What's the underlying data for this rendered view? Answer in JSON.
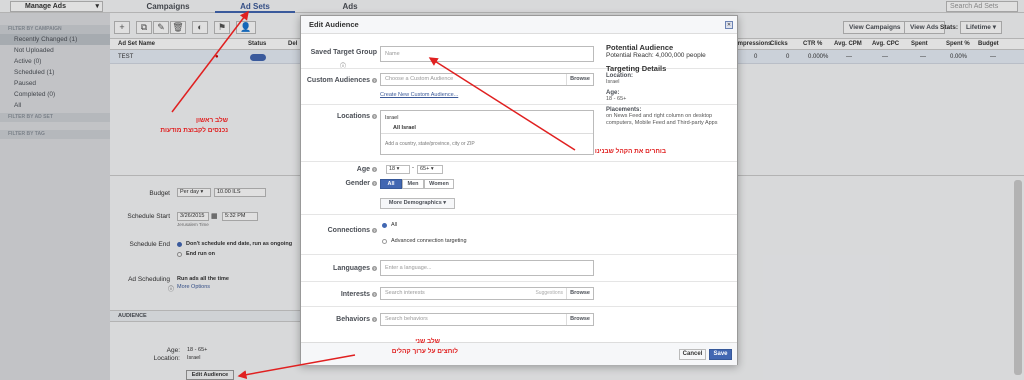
{
  "topbar": {
    "manage_label": "Manage Ads",
    "tabs": [
      "Campaigns",
      "Ad Sets",
      "Ads"
    ],
    "search_placeholder": "Search Ad Sets"
  },
  "sidebar": {
    "filter_campaign": "FILTER BY CAMPAIGN",
    "items": [
      "Recently Changed (1)",
      "Not Uploaded",
      "Active (0)",
      "Scheduled (1)",
      "Paused",
      "Completed (0)",
      "All"
    ],
    "filter_adset": "FILTER BY AD SET",
    "filter_tag": "FILTER BY TAG"
  },
  "toolbar": {
    "view_campaigns": "View Campaigns",
    "view_ads": "View Ads",
    "stats_label": "Stats:",
    "lifetime": "Lifetime"
  },
  "table": {
    "headers": [
      "Ad Set Name",
      "Status",
      "Del",
      "Impressions",
      "Clicks",
      "CTR %",
      "Avg. CPM",
      "Avg. CPC",
      "Spent",
      "Spent %",
      "Budget Remaining"
    ],
    "row": {
      "name": "TEST",
      "impressions": "0",
      "clicks": "0",
      "ctr": "0.000%",
      "cpm": "—",
      "cpc": "—",
      "spent": "—",
      "spent_pct": "0.00%",
      "budget": "—"
    }
  },
  "panel": {
    "budget_label": "Budget",
    "budget_type": "Per day",
    "budget_value": "10.00 ILS",
    "schedule_start_label": "Schedule Start",
    "start_date": "3/26/2015",
    "start_time": "5:32 PM",
    "tz": "Jerusalem Time",
    "schedule_end_label": "Schedule End",
    "end_opt1": "Don't schedule end date, run as ongoing",
    "end_opt2": "End run on",
    "ad_scheduling_label": "Ad Scheduling",
    "ad_scheduling_value": "Run ads all the time",
    "more_options": "More Options",
    "audience_header": "AUDIENCE",
    "age_label": "Age:",
    "age_value": "18 - 65+",
    "location_label": "Location:",
    "location_value": "Israel",
    "edit_audience": "Edit Audience"
  },
  "modal": {
    "title": "Edit Audience",
    "saved_target_label": "Saved Target Group",
    "saved_target_placeholder": "Name",
    "custom_aud_label": "Custom Audiences",
    "custom_aud_placeholder": "Choose a Custom Audience",
    "browse": "Browse",
    "create_custom": "Create New Custom Audience...",
    "locations_label": "Locations",
    "loc_country": "Israel",
    "loc_all": "All Israel",
    "loc_placeholder": "Add a country, state/province, city or ZIP",
    "age_label": "Age",
    "age_min": "18",
    "age_max": "65+",
    "age_dash": "-",
    "gender_label": "Gender",
    "gender_all": "All",
    "gender_men": "Men",
    "gender_women": "Women",
    "more_demo": "More Demographics",
    "connections_label": "Connections",
    "conn_all": "All",
    "conn_adv": "Advanced connection targeting",
    "languages_label": "Languages",
    "lang_placeholder": "Enter a language...",
    "interests_label": "Interests",
    "interests_placeholder": "Search interests",
    "suggestions": "Suggestions",
    "behaviors_label": "Behaviors",
    "behaviors_placeholder": "Search behaviors",
    "cancel": "Cancel",
    "save": "Save",
    "pot_title": "Potential Audience",
    "pot_reach": "Potential Reach: 4,000,000 people",
    "td_title": "Targeting Details",
    "td_loc": "Location:",
    "td_loc_val": "Israel",
    "td_age": "Age:",
    "td_age_val": "18 - 65+",
    "td_place": "Placements:",
    "td_place_val": "on News Feed and right column on desktop computers, Mobile Feed and Third-party Apps"
  },
  "notes": {
    "step1_line1": "שלב ראשון",
    "step1_line2": "נכנסים לקבוצת מודעות",
    "step2_line1": "שלב שני",
    "step2_line2": "לוחצים על ערוך קהלים",
    "arrow_note": "בוחרים את הקהל שבנינו"
  },
  "colors": {
    "accent": "#4267b2",
    "annotation": "#e02020"
  }
}
